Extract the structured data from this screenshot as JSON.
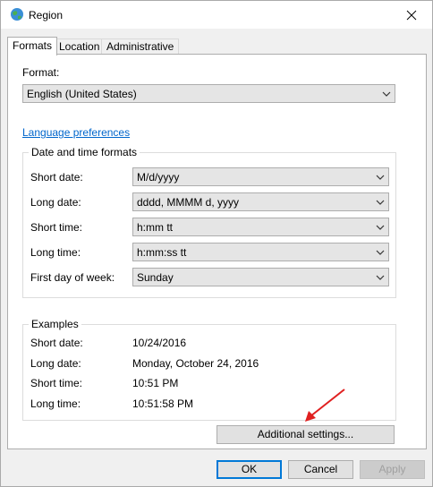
{
  "window": {
    "title": "Region",
    "close_label": "✕"
  },
  "tabs": [
    {
      "label": "Formats",
      "active": true
    },
    {
      "label": "Location",
      "active": false
    },
    {
      "label": "Administrative",
      "active": false
    }
  ],
  "format": {
    "label": "Format:",
    "value": "English (United States)"
  },
  "language_link": "Language preferences",
  "datetime": {
    "title": "Date and time formats",
    "rows": [
      {
        "label": "Short date:",
        "value": "M/d/yyyy"
      },
      {
        "label": "Long date:",
        "value": "dddd, MMMM d, yyyy"
      },
      {
        "label": "Short time:",
        "value": "h:mm tt"
      },
      {
        "label": "Long time:",
        "value": "h:mm:ss tt"
      },
      {
        "label": "First day of week:",
        "value": "Sunday"
      }
    ]
  },
  "examples": {
    "title": "Examples",
    "rows": [
      {
        "label": "Short date:",
        "value": "10/24/2016"
      },
      {
        "label": "Long date:",
        "value": "Monday, October 24, 2016"
      },
      {
        "label": "Short time:",
        "value": "10:51 PM"
      },
      {
        "label": "Long time:",
        "value": "10:51:58 PM"
      }
    ]
  },
  "buttons": {
    "additional": "Additional settings...",
    "ok": "OK",
    "cancel": "Cancel",
    "apply": "Apply"
  },
  "colors": {
    "accent": "#0078d7",
    "link": "#0066cc",
    "annotation": "#e02020"
  }
}
